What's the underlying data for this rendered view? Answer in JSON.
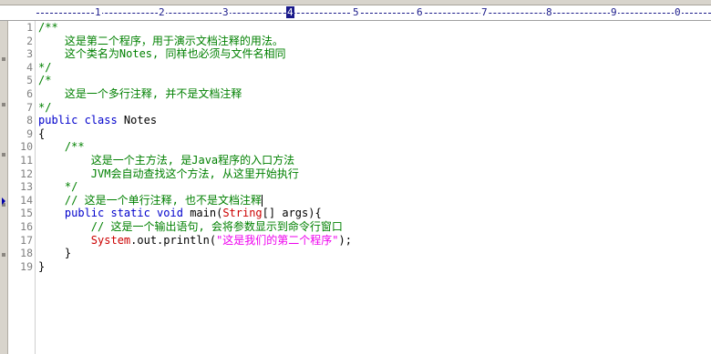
{
  "ruler": {
    "marks": [
      "1",
      "2",
      "3",
      "4",
      "5",
      "6",
      "7",
      "8",
      "9",
      "0"
    ],
    "active_index": 3
  },
  "colors": {
    "comment": "#008000",
    "keyword": "#0000cc",
    "type": "#cc0000",
    "string": "#ee00ee"
  },
  "lines": [
    {
      "n": "1",
      "t": [
        [
          "cmt",
          "/**"
        ]
      ]
    },
    {
      "n": "2",
      "t": [
        [
          "cmt",
          "    这是第二个程序，用于演示文档注释的用法。"
        ]
      ]
    },
    {
      "n": "3",
      "t": [
        [
          "cmt",
          "    这个类名为Notes, 同样也必须与文件名相同"
        ]
      ]
    },
    {
      "n": "4",
      "t": [
        [
          "cmt",
          "*/"
        ]
      ]
    },
    {
      "n": "5",
      "t": [
        [
          "cmt",
          "/*"
        ]
      ]
    },
    {
      "n": "6",
      "t": [
        [
          "cmt",
          "    这是一个多行注释, 并不是文档注释"
        ]
      ]
    },
    {
      "n": "7",
      "t": [
        [
          "cmt",
          "*/"
        ]
      ]
    },
    {
      "n": "8",
      "t": [
        [
          "kw",
          "public class "
        ],
        [
          "plain",
          "Notes"
        ]
      ]
    },
    {
      "n": "9",
      "t": [
        [
          "plain",
          "{"
        ]
      ]
    },
    {
      "n": "10",
      "t": [
        [
          "cmt",
          "    /**"
        ]
      ]
    },
    {
      "n": "11",
      "t": [
        [
          "cmt",
          "        这是一个主方法, 是Java程序的入口方法"
        ]
      ]
    },
    {
      "n": "12",
      "t": [
        [
          "cmt",
          "        JVM会自动查找这个方法, 从这里开始执行"
        ]
      ]
    },
    {
      "n": "13",
      "t": [
        [
          "cmt",
          "    */"
        ]
      ]
    },
    {
      "n": "14",
      "t": [
        [
          "cmt",
          "    // 这是一个单行注释, 也不是文档注释"
        ]
      ],
      "current": true
    },
    {
      "n": "15",
      "t": [
        [
          "plain",
          "    "
        ],
        [
          "kw",
          "public static void "
        ],
        [
          "plain",
          "main("
        ],
        [
          "type",
          "String"
        ],
        [
          "plain",
          "[] args){"
        ]
      ]
    },
    {
      "n": "16",
      "t": [
        [
          "cmt",
          "        // 这是一个输出语句, 会将参数显示到命令行窗口"
        ]
      ]
    },
    {
      "n": "17",
      "t": [
        [
          "plain",
          "        "
        ],
        [
          "type",
          "System"
        ],
        [
          "plain",
          ".out.println("
        ],
        [
          "str",
          "\"这是我们的第二个程序\""
        ],
        [
          "plain",
          ");"
        ]
      ]
    },
    {
      "n": "18",
      "t": [
        [
          "plain",
          "    }"
        ]
      ]
    },
    {
      "n": "19",
      "t": [
        [
          "plain",
          "}"
        ]
      ]
    }
  ]
}
